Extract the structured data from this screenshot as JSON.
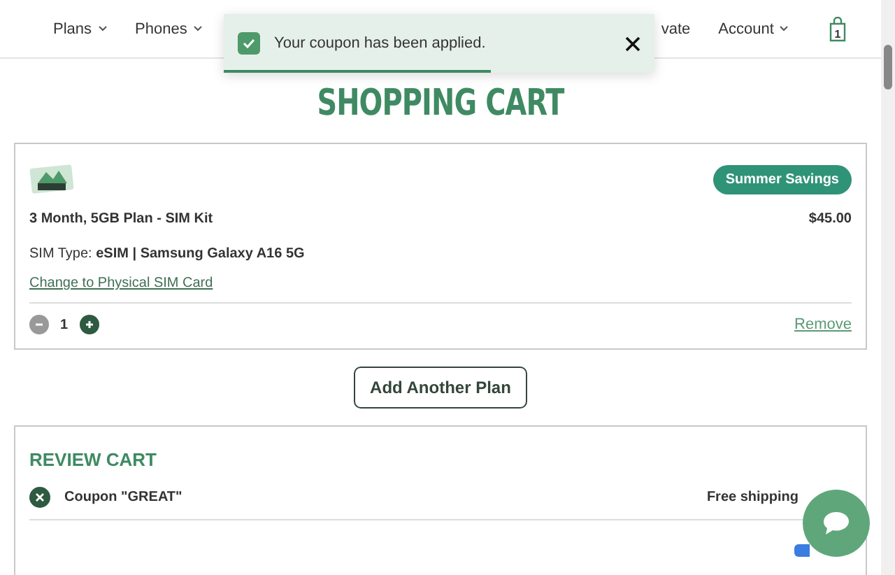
{
  "nav": {
    "items": [
      {
        "label": "Plans",
        "dropdown": true
      },
      {
        "label": "Phones",
        "dropdown": true
      },
      {
        "label": "vate",
        "dropdown": false
      },
      {
        "label": "Account",
        "dropdown": true
      }
    ],
    "cart_count": "1"
  },
  "toast": {
    "message": "Your coupon has been applied.",
    "level": 0.62
  },
  "title": "SHOPPING CART",
  "cart_item": {
    "badge": "Summer Savings",
    "name": "3 Month, 5GB Plan - SIM Kit",
    "price": "$45.00",
    "sim_type": "SIM Type: **eSIM | Samsung Galaxy A16 5G**",
    "change_link": "Change to Physical SIM Card",
    "quantity": "1",
    "minus_disabled": true,
    "remove": "Remove"
  },
  "add_button": "Add Another Plan",
  "review": {
    "heading": "REVIEW CART",
    "coupon": "Coupon \"GREAT\"",
    "shipping": "Free shipping"
  }
}
